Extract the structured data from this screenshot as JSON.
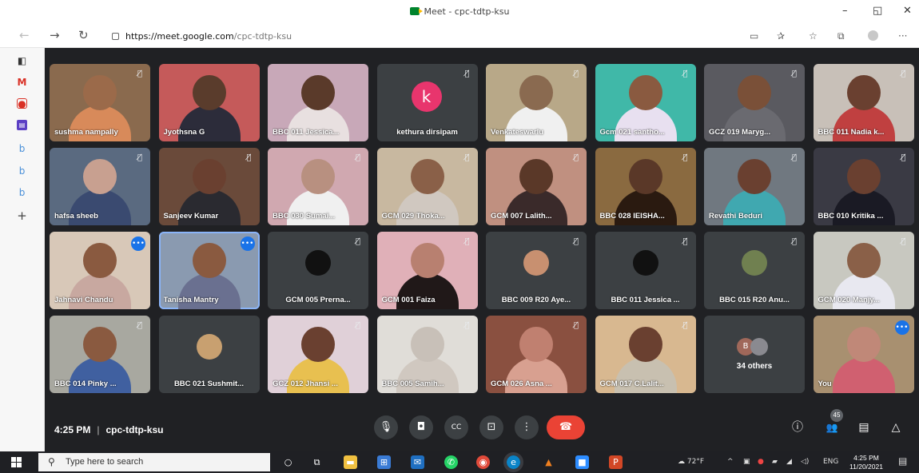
{
  "window": {
    "title": "Meet - cpc-tdtp-ksu",
    "minimize": "–",
    "restore": "◱",
    "close": "✕"
  },
  "addressbar": {
    "url_host": "https://meet.google.com",
    "url_path": "/cpc-tdtp-ksu",
    "back": "←",
    "forward": "→",
    "refresh": "↻",
    "more": "···"
  },
  "meeting": {
    "time": "4:25 PM",
    "code": "cpc-tdtp-ksu",
    "participant_badge": "45",
    "tiles": [
      {
        "name": "sushma nampally",
        "mute": true,
        "bg": "#8a6a4e",
        "skin": "#9b6a4a",
        "shirt": "#d88a5a"
      },
      {
        "name": "Jyothsna G",
        "mute": false,
        "bg": "#c55a5a",
        "skin": "#5a3c2c",
        "shirt": "#2c2c3a"
      },
      {
        "name": "BBC 011 Jessica...",
        "mute": false,
        "bg": "#c8a8b8",
        "skin": "#5a3a2a",
        "shirt": "#e8e0e0"
      },
      {
        "name": "kethura dirsipam",
        "mute": true,
        "avatar": "k",
        "avatar_color": "#e8356d"
      },
      {
        "name": "Venkateswarlu",
        "mute": true,
        "bg": "#b8a888",
        "skin": "#8a6a50",
        "shirt": "#f0f0f0"
      },
      {
        "name": "Gcm 021 santho...",
        "mute": true,
        "bg": "#40b8a8",
        "skin": "#8a5a40",
        "shirt": "#e8e0f0"
      },
      {
        "name": "GCZ 019 Maryg...",
        "mute": true,
        "bg": "#5a5a60",
        "skin": "#7a5038",
        "shirt": "#6a6a70"
      },
      {
        "name": "BBC 011 Nadia k...",
        "mute": true,
        "bg": "#c8c0b8",
        "skin": "#6a4030",
        "shirt": "#c04040"
      },
      {
        "name": "hafsa sheeb",
        "mute": true,
        "bg": "#5a6a80",
        "skin": "#c8a090",
        "shirt": "#3a4a70"
      },
      {
        "name": "Sanjeev Kumar",
        "mute": true,
        "bg": "#6a4a3a",
        "skin": "#6a4030",
        "shirt": "#2a2a30"
      },
      {
        "name": "BBC 030 Sumai...",
        "mute": true,
        "bg": "#d0a8b0",
        "skin": "#b89080",
        "shirt": "#f0f0f0"
      },
      {
        "name": "GCM 029 Thoka...",
        "mute": true,
        "bg": "#c8b8a0",
        "skin": "#8a6048",
        "shirt": "#d0c8c0"
      },
      {
        "name": "GCM 007 Lalith...",
        "mute": true,
        "bg": "#c09080",
        "skin": "#5a3828",
        "shirt": "#3a2a2a"
      },
      {
        "name": "BBC 028 IEISHA...",
        "mute": true,
        "bg": "#8a6a40",
        "skin": "#5a3828",
        "shirt": "#2a1a10"
      },
      {
        "name": "Revathi Beduri",
        "mute": true,
        "bg": "#707880",
        "skin": "#6a4030",
        "shirt": "#40a8b0"
      },
      {
        "name": "BBC 010 Kritika ...",
        "mute": true,
        "bg": "#3a3a44",
        "skin": "#6a4030",
        "shirt": "#1a1a24"
      },
      {
        "name": "Jahnavi Chandu",
        "speaking": true,
        "bg": "#d8c8b8",
        "skin": "#8a5a40",
        "shirt": "#c8a8a0"
      },
      {
        "name": "Tanisha Mantry",
        "speaking": true,
        "active": true,
        "bg": "#8a9ab0",
        "skin": "#8a5a40",
        "shirt": "#6a7090"
      },
      {
        "name": "GCM 005 Prerna...",
        "mute": true,
        "mini_color": "#111111"
      },
      {
        "name": "GCM 001 Faiza",
        "mute": true,
        "bg": "#e0b0b8",
        "skin": "#b88070",
        "shirt": "#201818"
      },
      {
        "name": "BBC 009 R20 Aye...",
        "mute": true,
        "mini_color": "#c89070"
      },
      {
        "name": "BBC 011 Jessica ...",
        "mute": true,
        "mini_color": "#111111"
      },
      {
        "name": "BBC 015 R20 Anu...",
        "mute": true,
        "mini_color": "#708050"
      },
      {
        "name": "GCM 020 Manjy...",
        "mute": true,
        "bg": "#c8c8c0",
        "skin": "#8a6048",
        "shirt": "#e8e8f0"
      },
      {
        "name": "BBC 014 Pinky ...",
        "mute": true,
        "bg": "#a8a8a0",
        "skin": "#8a5a40",
        "shirt": "#4060a0"
      },
      {
        "name": "BBC 021 Sushmit...",
        "mute": false,
        "mini_color": "#c8a070"
      },
      {
        "name": "GCZ 012 Jhansi ...",
        "mute": true,
        "bg": "#e0d0d8",
        "skin": "#6a4030",
        "shirt": "#e8c050"
      },
      {
        "name": "BBC 005 Samih...",
        "mute": true,
        "bg": "#e0ddd8",
        "skin": "#c8c0b8",
        "shirt": "#d0c8c0"
      },
      {
        "name": "GCM 026 Asna ...",
        "mute": true,
        "bg": "#8a5040",
        "skin": "#c08070",
        "shirt": "#d8a090"
      },
      {
        "name": "GCM 017 C.Lalit...",
        "mute": true,
        "bg": "#d8b890",
        "skin": "#6a4030",
        "shirt": "#c8c0b0"
      },
      {
        "name": "34 others",
        "others": true
      },
      {
        "name": "You",
        "speaking": true,
        "bg": "#a89070",
        "skin": "#c08878",
        "shirt": "#d06070"
      }
    ]
  },
  "controls": {
    "mic": "🎙",
    "camera": "◘",
    "captions": "CC",
    "present": "⊡",
    "more": "⋮",
    "hangup": "☎",
    "info": "ⓘ",
    "people": "👥",
    "chat": "▤",
    "activities": "△"
  },
  "taskbar": {
    "search_placeholder": "Type here to search",
    "weather": "72°F",
    "language": "ENG",
    "time": "4:25 PM",
    "date": "11/20/2021"
  }
}
